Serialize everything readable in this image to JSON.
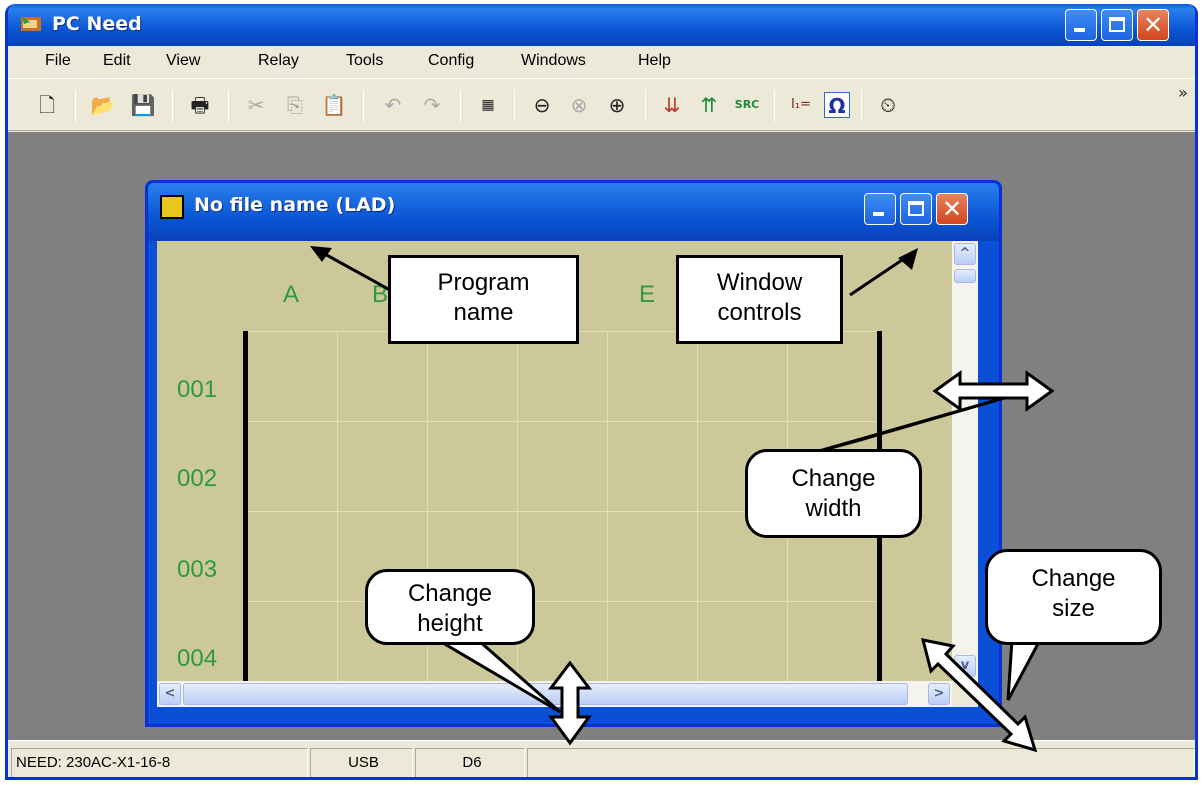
{
  "app": {
    "title": "PC Need"
  },
  "menu": [
    "File",
    "Edit",
    "View",
    "Relay",
    "Tools",
    "Config",
    "Windows",
    "Help"
  ],
  "toolbar": {
    "icons": [
      "new-icon",
      "open-icon",
      "save-icon",
      "print-icon",
      "cut-icon",
      "copy-icon",
      "paste-icon",
      "undo-icon",
      "redo-icon",
      "compile-icon",
      "zoom-out-icon",
      "zoom-reset-icon",
      "zoom-in-icon",
      "read-from-relay-icon",
      "write-to-relay-icon",
      "source-icon",
      "input-status-icon",
      "monitor-icon",
      "clock-icon"
    ],
    "overflow": "»"
  },
  "child": {
    "title": "No file name (LAD)",
    "columns": [
      "A",
      "B",
      "E"
    ],
    "rows": [
      "001",
      "002",
      "003",
      "004"
    ]
  },
  "callouts": {
    "program_name": [
      "Program",
      "name"
    ],
    "window_controls": [
      "Window",
      "controls"
    ],
    "change_width": [
      "Change",
      "width"
    ],
    "change_height": [
      "Change",
      "height"
    ],
    "change_size": [
      "Change",
      "size"
    ]
  },
  "status": {
    "device": "NEED: 230AC-X1-16-8",
    "port": "USB",
    "version": "D6"
  },
  "colors": {
    "title_blue": "#0a5fd8",
    "ladder_bg": "#cdc89a",
    "ladder_text": "#2e9a3e"
  }
}
